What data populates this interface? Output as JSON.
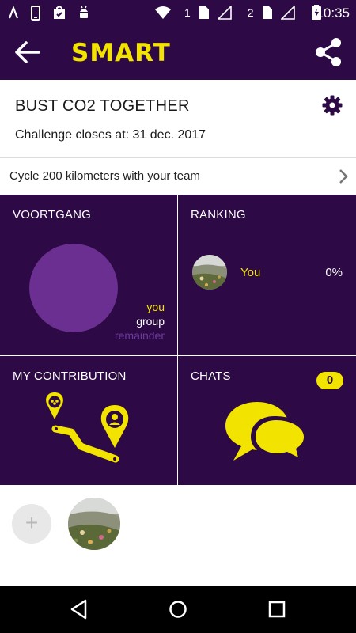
{
  "status_bar": {
    "time": "10:35",
    "sim1": "1",
    "sim2": "2",
    "icons": [
      "notification-a-icon",
      "phone-icon",
      "shopping-bag-icon",
      "android-icon",
      "wifi-icon",
      "signal-icon",
      "battery-charging-icon"
    ]
  },
  "app_bar": {
    "logo": "SMART"
  },
  "challenge": {
    "title": "BUST CO2 TOGETHER",
    "closes": "Challenge closes at: 31 dec. 2017",
    "goal": "Cycle 200 kilometers with your team"
  },
  "progress_tile": {
    "label": "VOORTGANG",
    "legend_you": "you",
    "legend_group": "group",
    "legend_remainder": "remainder"
  },
  "ranking_tile": {
    "label": "RANKING",
    "entries": [
      {
        "name": "You",
        "percent": "0%"
      }
    ]
  },
  "contribution_tile": {
    "label": "MY CONTRIBUTION"
  },
  "chats_tile": {
    "label": "CHATS",
    "count": "0"
  },
  "members": {
    "add_label": "+"
  },
  "colors": {
    "primary": "#2d0a45",
    "accent": "#f3e300",
    "remainder": "#6b2e91",
    "divider": "#dcdcdc"
  }
}
